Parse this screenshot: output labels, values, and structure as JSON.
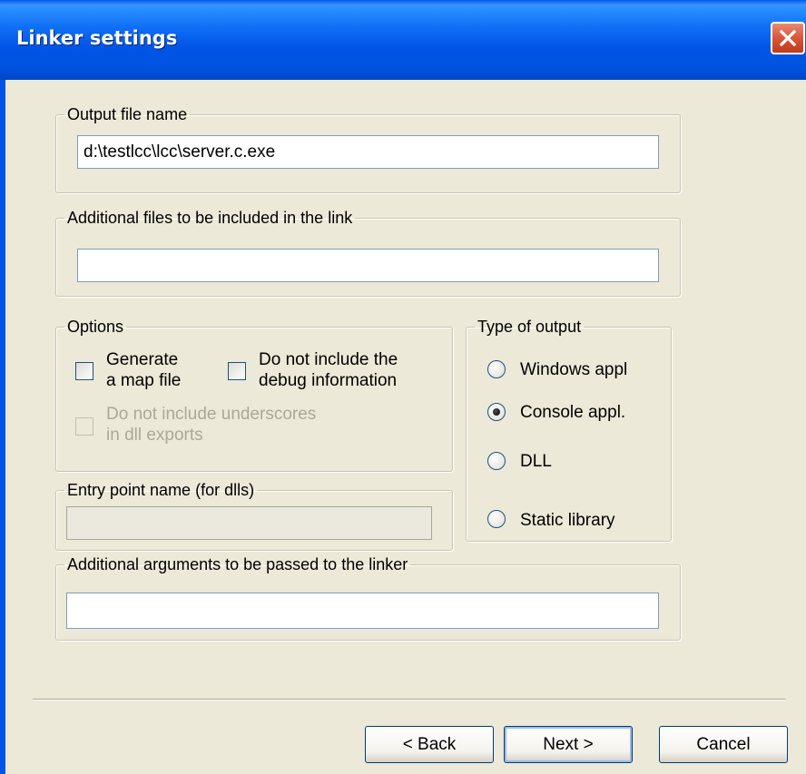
{
  "window": {
    "title": "Linker settings"
  },
  "output_file": {
    "legend": "Output file name",
    "value": "d:\\testlcc\\lcc\\server.c.exe"
  },
  "additional_files": {
    "legend": "Additional files to be included in the link",
    "value": ""
  },
  "options": {
    "legend": "Options",
    "generate_map": {
      "label_line1": "Generate",
      "label_line2": "a map file",
      "checked": false
    },
    "no_debug": {
      "label_line1": "Do not include the",
      "label_line2": "debug information",
      "checked": false
    },
    "no_underscores": {
      "label_line1": "Do not include underscores",
      "label_line2": "in dll exports",
      "checked": false,
      "enabled": false
    }
  },
  "output_type": {
    "legend": "Type of output",
    "options": [
      {
        "label": "Windows appl",
        "selected": false
      },
      {
        "label": "Console appl.",
        "selected": true
      },
      {
        "label": "DLL",
        "selected": false
      },
      {
        "label": "Static library",
        "selected": false
      }
    ]
  },
  "entry_point": {
    "legend": "Entry point name (for dlls)",
    "value": "",
    "enabled": false
  },
  "additional_args": {
    "legend": "Additional arguments to be passed to the linker",
    "value": ""
  },
  "buttons": {
    "back": "< Back",
    "next": "Next >",
    "cancel": "Cancel"
  }
}
